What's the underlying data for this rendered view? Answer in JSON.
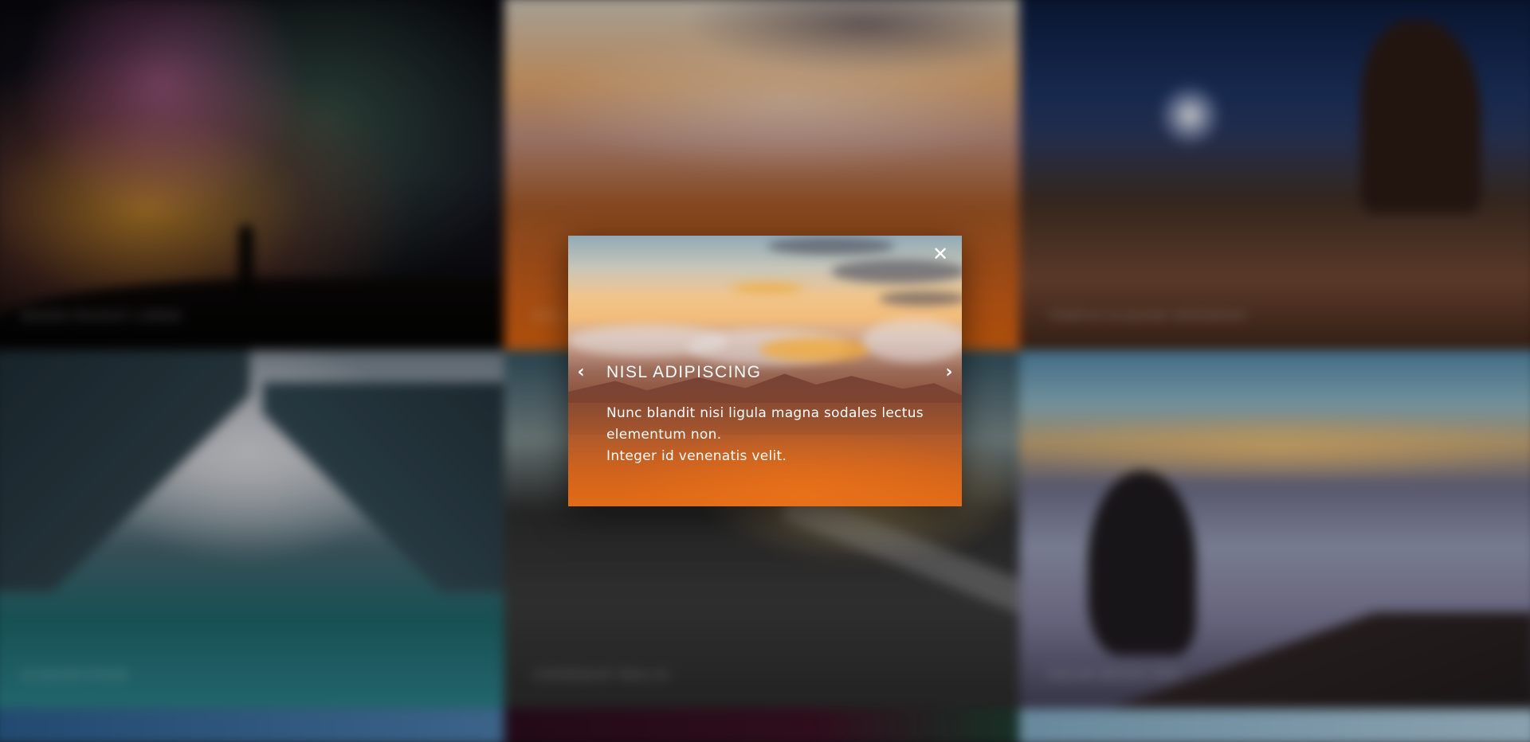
{
  "gallery": {
    "tiles": [
      {
        "caption": "Magna feugiat lorem"
      },
      {
        "caption": "Nisl adipiscing"
      },
      {
        "caption": "Tempus aliquam veroeros"
      },
      {
        "caption": "Aliquam ipsum"
      },
      {
        "caption": "Consequat mollis"
      },
      {
        "caption": "Dolor magna sem"
      }
    ]
  },
  "lightbox": {
    "title": "NISL ADIPISCING",
    "text_lines": [
      "Nunc blandit nisi ligula magna sodales lectus",
      "elementum non.",
      "Integer id venenatis velit."
    ],
    "close_glyph": "✕",
    "prev_glyph": "‹",
    "next_glyph": "›",
    "icons": {
      "close": "close-icon",
      "prev": "chevron-left-icon",
      "next": "chevron-right-icon"
    }
  }
}
